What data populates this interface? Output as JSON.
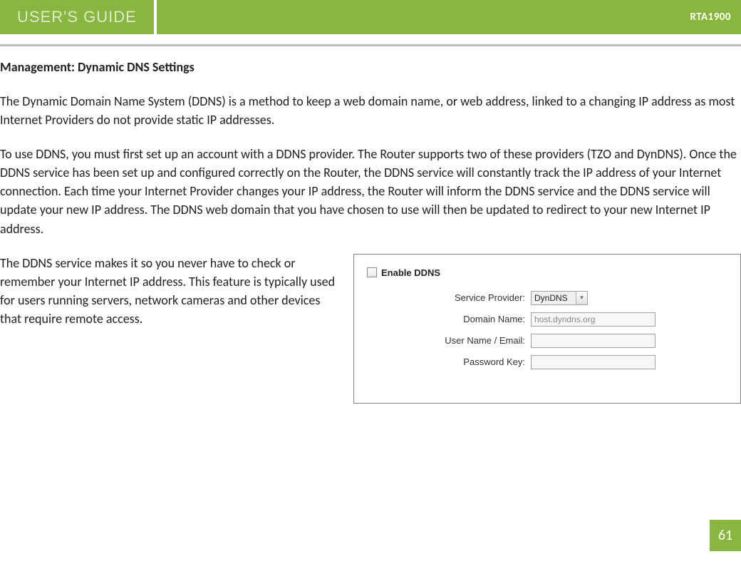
{
  "header": {
    "title": "USER'S GUIDE",
    "model": "RTA1900"
  },
  "section_title": "Management: Dynamic DNS Settings",
  "para1": "The Dynamic Domain Name System (DDNS) is a method to keep a web domain name, or web address, linked to a changing IP address as most Internet Providers do not provide static IP addresses.",
  "para2": "To use DDNS, you must first set up an account with a DDNS provider. The Router supports two of these providers (TZO and DynDNS). Once the DDNS service has been set up and configured correctly on the Router, the DDNS service will constantly track the IP address of your Internet connection. Each time your Internet Provider changes your IP address, the Router will inform the DDNS service and the DDNS service will update your new IP address.  The DDNS web domain that you have chosen to use will then be updated to redirect to your new Internet IP address.",
  "para3": "The DDNS service makes it so you never have to check or remember your Internet IP address. This feature is typically used for users running servers, network cameras and other devices that require remote access.",
  "panel": {
    "enable_label": "Enable DDNS",
    "service_provider_label": "Service Provider:",
    "service_provider_value": "DynDNS",
    "domain_name_label": "Domain Name:",
    "domain_name_value": "host.dyndns.org",
    "user_name_label": "User Name / Email:",
    "user_name_value": "",
    "password_label": "Password Key:",
    "password_value": ""
  },
  "page_number": "61"
}
